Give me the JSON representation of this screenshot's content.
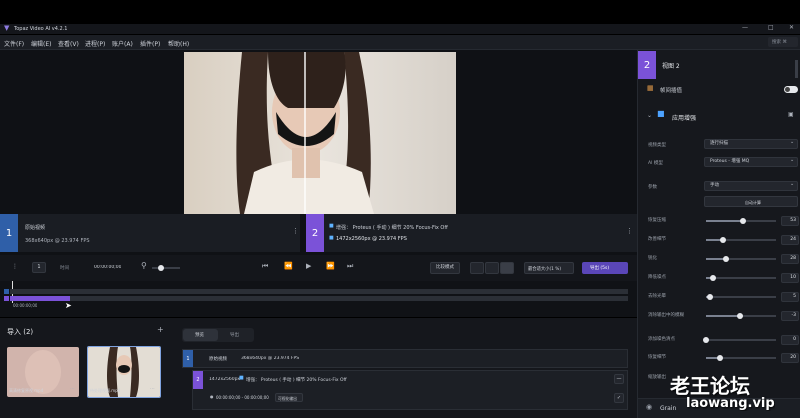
{
  "app": {
    "title": "Topaz Video AI  v4.2.1",
    "search_placeholder": "搜索 ⌘",
    "minimize": "—",
    "maximize": "□",
    "close": "✕"
  },
  "menu": [
    "文件(F)",
    "编辑(E)",
    "查看(V)",
    "进程(P)",
    "账户(A)",
    "插件(P)",
    "帮助(H)"
  ],
  "preview": {
    "left_num": "1",
    "left_title": "原始视频",
    "left_info": "368x640px @ 23.974 FPS",
    "right_num": "2",
    "right_line1": "增强： Proteus ( 手动 ) 细节 20% Focus-Fix Off",
    "right_line2": "1472x2560px @ 23.974 FPS"
  },
  "toolbar": {
    "frame_field": "1",
    "time_label": "时间",
    "timecode": "00:00:00;00",
    "compare_mode": "比较模式",
    "zoom": "最合适大小(1 %)",
    "export_btn": "导出 (5s)"
  },
  "timeline": {
    "start_time": "00:00:00;00"
  },
  "imports": {
    "title": "导入 (2)",
    "items": [
      {
        "name": "高清修复原视.mp4"
      },
      {
        "name": "待处理视频.mp4"
      }
    ]
  },
  "output": {
    "tabs": [
      "预览",
      "导出"
    ],
    "row1_num": "1",
    "row1_title": "原始视频",
    "row1_info": "368x640px @ 23.974 FPS",
    "row2_num": "2",
    "row2_res": "1472x2560px",
    "row2_desc": "增强： Proteus ( 手动 ) 细节 20% Focus-Fix Off",
    "row2_time": "00:00:00;00 - 00:00:00;00",
    "row2_btn": "可视化输出"
  },
  "sidebar": {
    "view_num": "2",
    "view_title": "视图 2",
    "frame_interp": "帧间插值",
    "enhance": "应用增强",
    "rows": [
      {
        "label": "视频类型",
        "value": "逐行扫描"
      },
      {
        "label": "AI 模型",
        "value": "Proteus - 增强 MQ"
      },
      {
        "label": "参数",
        "value": "手动"
      }
    ],
    "auto_btn": "自动计算",
    "sliders": [
      {
        "label": "恢复压缩",
        "value": "53",
        "level": 0.53
      },
      {
        "label": "改善细节",
        "value": "24",
        "level": 0.24
      },
      {
        "label": "锐化",
        "value": "28",
        "level": 0.28
      },
      {
        "label": "降低噪点",
        "value": "10",
        "level": 0.1
      },
      {
        "label": "去除光晕",
        "value": "5",
        "level": 0.05
      },
      {
        "label": "消除输出中的模糊",
        "value": "-3",
        "level": 0.485
      },
      {
        "label": "添加噪色清点",
        "value": "0",
        "level": 0.0
      },
      {
        "label": "恢复细节",
        "value": "20",
        "level": 0.2
      }
    ],
    "last_label": "缩放输出",
    "grain": "Grain"
  },
  "watermark": {
    "line1": "老王论坛",
    "line2": "laowang.vip"
  },
  "colors": {
    "accent_purple": "#7b52d8",
    "accent_blue": "#2f5fa8",
    "bg_dark": "#15171c"
  }
}
